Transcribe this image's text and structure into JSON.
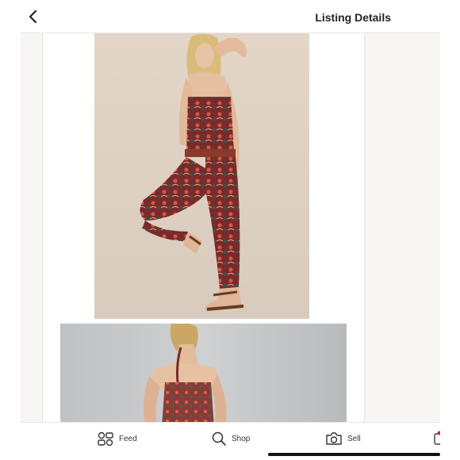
{
  "header": {
    "title": "Listing Details",
    "back_icon": "chevron-left-icon"
  },
  "gallery": {
    "photos": [
      {
        "alt": "product-photo-front"
      },
      {
        "alt": "product-photo-back"
      }
    ]
  },
  "bottom_nav": {
    "items": [
      {
        "label": "Feed",
        "icon": "feed-icon"
      },
      {
        "label": "Shop",
        "icon": "search-icon"
      },
      {
        "label": "Sell",
        "icon": "camera-icon"
      },
      {
        "label": "",
        "icon": "more-icon"
      }
    ]
  },
  "colors": {
    "accent": "#c53030",
    "text": "#222222",
    "background": "#f7f6f2"
  }
}
